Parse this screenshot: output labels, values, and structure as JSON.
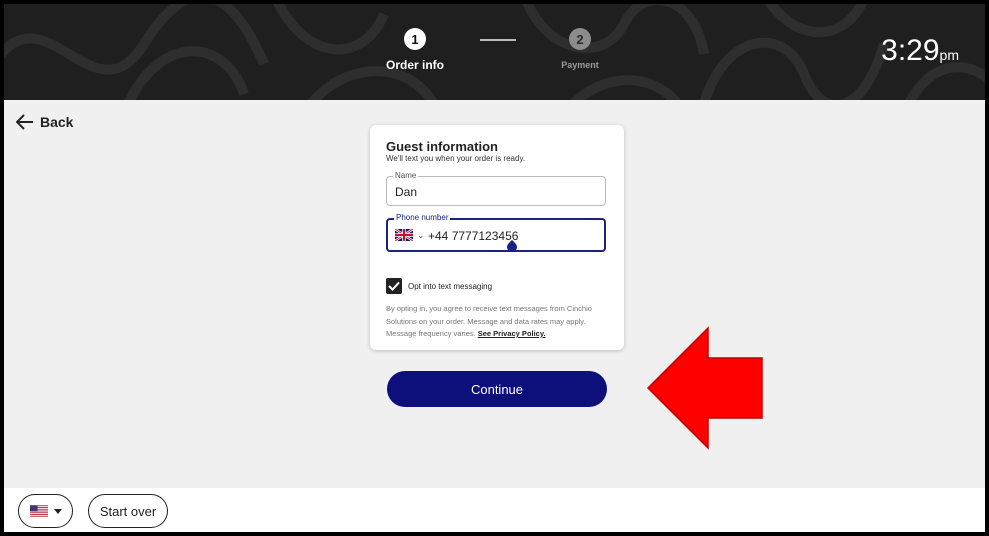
{
  "header": {
    "steps": [
      {
        "number": "1",
        "label": "Order info"
      },
      {
        "number": "2",
        "label": "Payment"
      }
    ],
    "clock": {
      "time": "3:29",
      "ampm": "pm"
    }
  },
  "nav": {
    "back_label": "Back",
    "back_icon": "arrow-left-icon"
  },
  "card": {
    "title": "Guest information",
    "subtitle": "We'll text you when your order is ready.",
    "name_field": {
      "label": "Name",
      "value": "Dan"
    },
    "phone_field": {
      "label": "Phone number",
      "country_flag": "uk-flag-icon",
      "value": "+44 7777123456"
    },
    "opt_in": {
      "label": "Opt into text messaging",
      "checked": true
    },
    "disclaimer": "By opting in, you agree to receive text messages from Cinchio Solutions on your order. Message and data rates may apply. Message frequency varies.",
    "privacy_link": "See Privacy Policy."
  },
  "actions": {
    "continue_label": "Continue"
  },
  "footer": {
    "language_flag": "us-flag-icon",
    "start_over_label": "Start over"
  },
  "annotation": {
    "arrow_color": "#ff0000"
  },
  "colors": {
    "primary": "#0d0f7a",
    "header_bg": "#1f1f1f"
  }
}
